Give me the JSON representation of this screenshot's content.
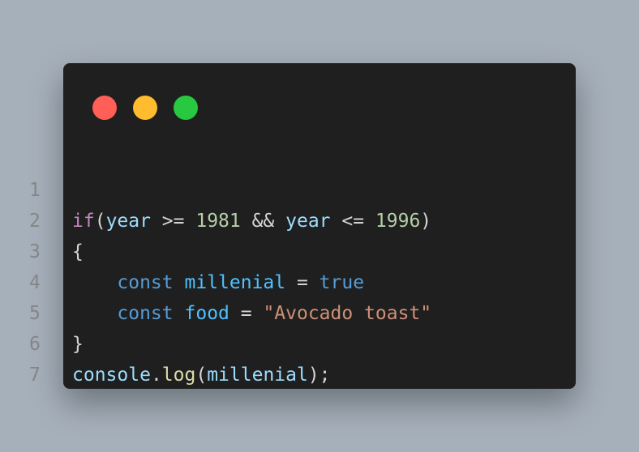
{
  "window": {
    "controls": {
      "close_color": "#ff5f57",
      "minimize_color": "#febc2e",
      "maximize_color": "#28c840"
    }
  },
  "code": {
    "lines": [
      {
        "number": "1",
        "tokens": {
          "t1": "if",
          "t2": "(",
          "t3": "year",
          "t4": " >= ",
          "t5": "1981",
          "t6": " && ",
          "t7": "year",
          "t8": " <= ",
          "t9": "1996",
          "t10": ")"
        }
      },
      {
        "number": "2",
        "tokens": {
          "t1": "{"
        }
      },
      {
        "number": "3",
        "tokens": {
          "indent": "    ",
          "t1": "const",
          "t2": " ",
          "t3": "millenial",
          "t4": " = ",
          "t5": "true"
        }
      },
      {
        "number": "4",
        "tokens": {
          "indent": "    ",
          "t1": "const",
          "t2": " ",
          "t3": "food",
          "t4": " = ",
          "t5": "\"Avocado toast\""
        }
      },
      {
        "number": "5",
        "tokens": {
          "t1": "}"
        }
      },
      {
        "number": "6",
        "tokens": {
          "t1": "console",
          "t2": ".",
          "t3": "log",
          "t4": "(",
          "t5": "millenial",
          "t6": ");"
        }
      },
      {
        "number": "7",
        "tokens": {}
      }
    ]
  }
}
